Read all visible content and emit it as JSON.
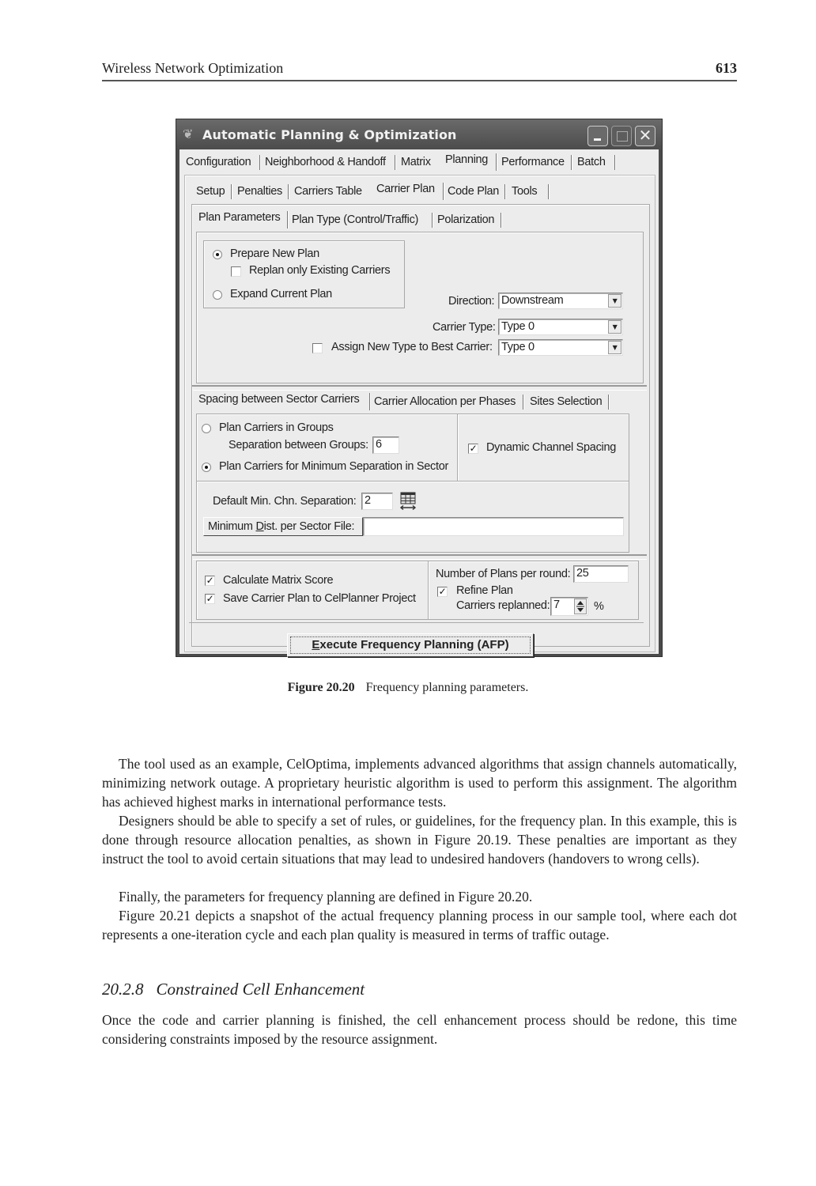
{
  "running_header": {
    "title": "Wireless Network Optimization",
    "page_number": "613"
  },
  "dialog": {
    "title": "Automatic Planning & Optimization",
    "title_icon": "app-logo-icon",
    "window_buttons": {
      "minimize": "minimize-icon",
      "maximize": "maximize-icon",
      "close": "close-icon",
      "close_glyph": "✕"
    },
    "main_tabs": [
      {
        "label": "Configuration",
        "active": false
      },
      {
        "label": "Neighborhood & Handoff",
        "active": false
      },
      {
        "label": "Matrix",
        "active": false
      },
      {
        "label": "Planning",
        "active": true
      },
      {
        "label": "Performance",
        "active": false
      },
      {
        "label": "Batch",
        "active": false
      }
    ],
    "sub_tabs": [
      {
        "label": "Setup",
        "active": false
      },
      {
        "label": "Penalties",
        "active": false
      },
      {
        "label": "Carriers Table",
        "active": false
      },
      {
        "label": "Carrier Plan",
        "active": true
      },
      {
        "label": "Code Plan",
        "active": false
      },
      {
        "label": "Tools",
        "active": false
      }
    ],
    "plan_tabs": [
      {
        "label": "Plan Parameters",
        "active": true
      },
      {
        "label": "Plan Type (Control/Traffic)",
        "active": false
      },
      {
        "label": "Polarization",
        "active": false
      }
    ],
    "plan_parameters": {
      "prepare_new_plan": {
        "label": "Prepare New Plan",
        "selected": true
      },
      "replan_existing": {
        "label": "Replan only Existing Carriers",
        "checked": false
      },
      "expand_current_plan": {
        "label": "Expand Current Plan",
        "selected": false
      },
      "direction": {
        "label": "Direction:",
        "value": "Downstream"
      },
      "carrier_type": {
        "label": "Carrier Type:",
        "value": "Type 0"
      },
      "assign_new_type": {
        "label": "Assign New Type to Best Carrier:",
        "checked": false,
        "value": "Type 0"
      },
      "dropdown_glyph": "▼"
    },
    "spacing_tabs": [
      {
        "label": "Spacing between Sector Carriers",
        "active": true
      },
      {
        "label": "Carrier Allocation per Phases",
        "active": false
      },
      {
        "label": "Sites Selection",
        "active": false
      }
    ],
    "spacing": {
      "plan_in_groups": {
        "label": "Plan Carriers in Groups",
        "selected": false
      },
      "separation_between_groups": {
        "label": "Separation between Groups:",
        "value": "6"
      },
      "plan_min_separation": {
        "label": "Plan Carriers for Minimum Separation in Sector",
        "selected": true
      },
      "dynamic_channel_spacing": {
        "label": "Dynamic Channel Spacing",
        "checked": true
      },
      "default_min_separation": {
        "label": "Default Min. Chn. Separation:",
        "value": "2"
      },
      "table_icon": "channel-table-icon",
      "min_dist_file": {
        "label_prefix": "Minimum ",
        "label_mnemonic": "D",
        "label_suffix": "ist. per Sector File:",
        "value": ""
      }
    },
    "options": {
      "calculate_matrix_score": {
        "label": "Calculate Matrix Score",
        "checked": true
      },
      "save_carrier_plan": {
        "label": "Save Carrier Plan to CelPlanner Project",
        "checked": true
      },
      "plans_per_round": {
        "label": "Number of Plans per round:",
        "value": "25"
      },
      "refine_plan": {
        "label": "Refine Plan",
        "checked": true
      },
      "carriers_replanned": {
        "label": "Carriers replanned:",
        "value": "7",
        "unit": "%"
      },
      "check_glyph": "✓"
    },
    "execute_button": {
      "mnemonic": "E",
      "label_rest": "xecute Frequency Planning (AFP)"
    }
  },
  "caption": {
    "label": "Figure 20.20",
    "text": "Frequency planning parameters."
  },
  "paragraphs": [
    "The tool used as an example, CelOptima, implements advanced algorithms that assign channels automatically, minimizing network outage. A proprietary heuristic algorithm is used to perform this assignment. The algorithm has achieved highest marks in international performance tests.",
    "Designers should be able to specify a set of rules, or guidelines, for the frequency plan. In this example, this is done through resource allocation penalties, as shown in Figure 20.19. These penalties are important as they instruct the tool to avoid certain situations that may lead to undesired handovers (handovers to wrong cells).",
    "Finally, the parameters for frequency planning are defined in Figure 20.20.",
    "Figure 20.21 depicts a snapshot of the actual frequency planning process in our sample tool, where each dot represents a one-iteration cycle and each plan quality is measured in terms of traffic outage."
  ],
  "section": {
    "number": "20.2.8",
    "title": "Constrained Cell Enhancement",
    "paragraph": "Once the code and carrier planning is finished, the cell enhancement process should be redone, this time considering constraints imposed by the resource assignment."
  }
}
